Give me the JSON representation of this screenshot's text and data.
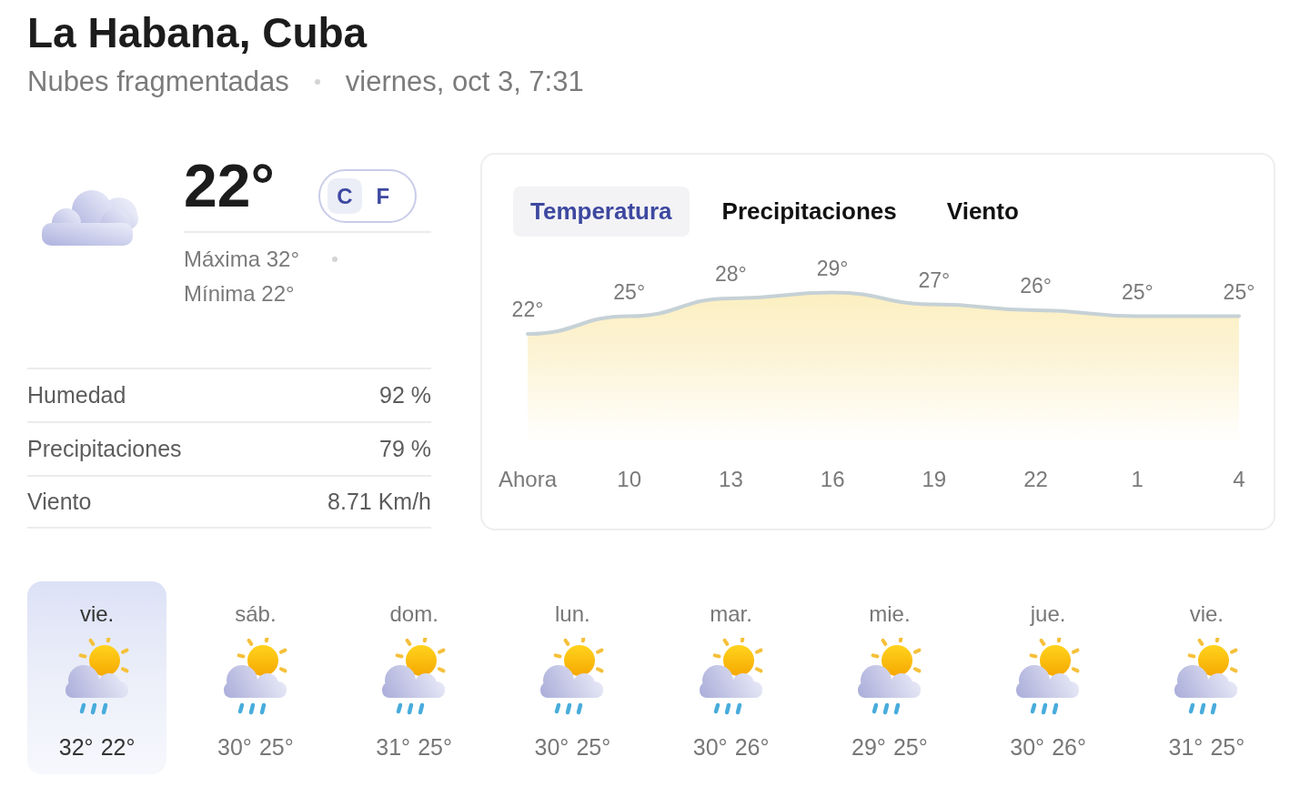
{
  "location": {
    "title": "La Habana, Cuba",
    "condition": "Nubes fragmentadas",
    "datetime": "viernes, oct 3, 7:31"
  },
  "current": {
    "temperature": "22°",
    "units": [
      {
        "label": "C",
        "selected": true
      },
      {
        "label": "F",
        "selected": false
      }
    ],
    "high": "Máxima 32°",
    "low": "Mínima 22°"
  },
  "details": [
    {
      "label": "Humedad",
      "value": "92 %"
    },
    {
      "label": "Precipitaciones",
      "value": "79 %"
    },
    {
      "label": "Viento",
      "value": "8.71 Km/h"
    }
  ],
  "chart_panel": {
    "tabs": [
      {
        "label": "Temperatura",
        "selected": true
      },
      {
        "label": "Precipitaciones",
        "selected": false
      },
      {
        "label": "Viento",
        "selected": false
      }
    ],
    "chart_data": {
      "type": "area",
      "categories": [
        "Ahora",
        "10",
        "13",
        "16",
        "19",
        "22",
        "1",
        "4"
      ],
      "values": [
        22,
        25,
        28,
        29,
        27,
        26,
        25,
        25
      ],
      "value_labels": [
        "22°",
        "25°",
        "28°",
        "29°",
        "27°",
        "26°",
        "25°",
        "25°"
      ]
    }
  },
  "forecast": [
    {
      "day": "vie.",
      "high": "32°",
      "low": "22°",
      "selected": true
    },
    {
      "day": "sáb.",
      "high": "30°",
      "low": "25°",
      "selected": false
    },
    {
      "day": "dom.",
      "high": "31°",
      "low": "25°",
      "selected": false
    },
    {
      "day": "lun.",
      "high": "30°",
      "low": "25°",
      "selected": false
    },
    {
      "day": "mar.",
      "high": "30°",
      "low": "26°",
      "selected": false
    },
    {
      "day": "mie.",
      "high": "29°",
      "low": "25°",
      "selected": false
    },
    {
      "day": "jue.",
      "high": "30°",
      "low": "26°",
      "selected": false
    },
    {
      "day": "vie.",
      "high": "31°",
      "low": "25°",
      "selected": false
    }
  ]
}
